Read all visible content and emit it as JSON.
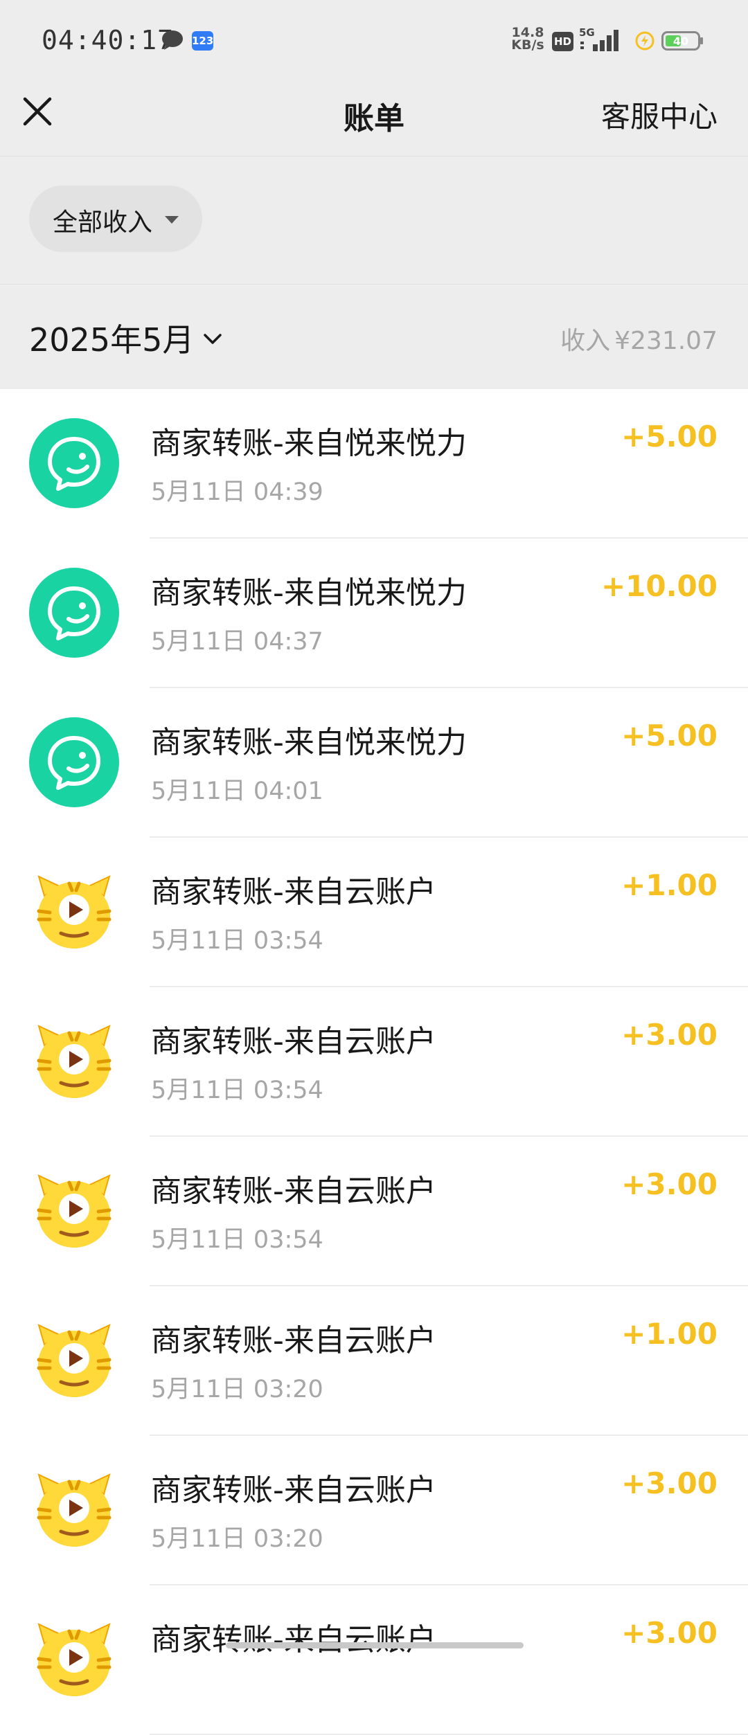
{
  "status_bar": {
    "time": "04:40:17",
    "app_badge": "123",
    "net_speed_value": "14.8",
    "net_speed_unit": "KB/s",
    "hd_label": "HD",
    "network": "5G",
    "battery_level": "40"
  },
  "nav": {
    "title": "账单",
    "action": "客服中心"
  },
  "filter": {
    "label": "全部收入"
  },
  "month": {
    "label": "2025年5月",
    "income_label": "收入",
    "income_value": "¥231.07"
  },
  "colors": {
    "amount": "#f6c022",
    "wechat_avatar": "#19d3a2",
    "tiger_avatar": "#ffd83a"
  },
  "transactions": [
    {
      "avatar": "wechat-pay-icon",
      "title": "商家转账-来自悦来悦力",
      "time": "5月11日 04:39",
      "amount": "+5.00"
    },
    {
      "avatar": "wechat-pay-icon",
      "title": "商家转账-来自悦来悦力",
      "time": "5月11日 04:37",
      "amount": "+10.00"
    },
    {
      "avatar": "wechat-pay-icon",
      "title": "商家转账-来自悦来悦力",
      "time": "5月11日 04:01",
      "amount": "+5.00"
    },
    {
      "avatar": "tiger-mascot-icon",
      "title": "商家转账-来自云账户",
      "time": "5月11日 03:54",
      "amount": "+1.00"
    },
    {
      "avatar": "tiger-mascot-icon",
      "title": "商家转账-来自云账户",
      "time": "5月11日 03:54",
      "amount": "+3.00"
    },
    {
      "avatar": "tiger-mascot-icon",
      "title": "商家转账-来自云账户",
      "time": "5月11日 03:54",
      "amount": "+3.00"
    },
    {
      "avatar": "tiger-mascot-icon",
      "title": "商家转账-来自云账户",
      "time": "5月11日 03:20",
      "amount": "+1.00"
    },
    {
      "avatar": "tiger-mascot-icon",
      "title": "商家转账-来自云账户",
      "time": "5月11日 03:20",
      "amount": "+3.00"
    },
    {
      "avatar": "tiger-mascot-icon",
      "title": "商家转账-来自云账户",
      "time": "",
      "amount": "+3.00"
    }
  ]
}
